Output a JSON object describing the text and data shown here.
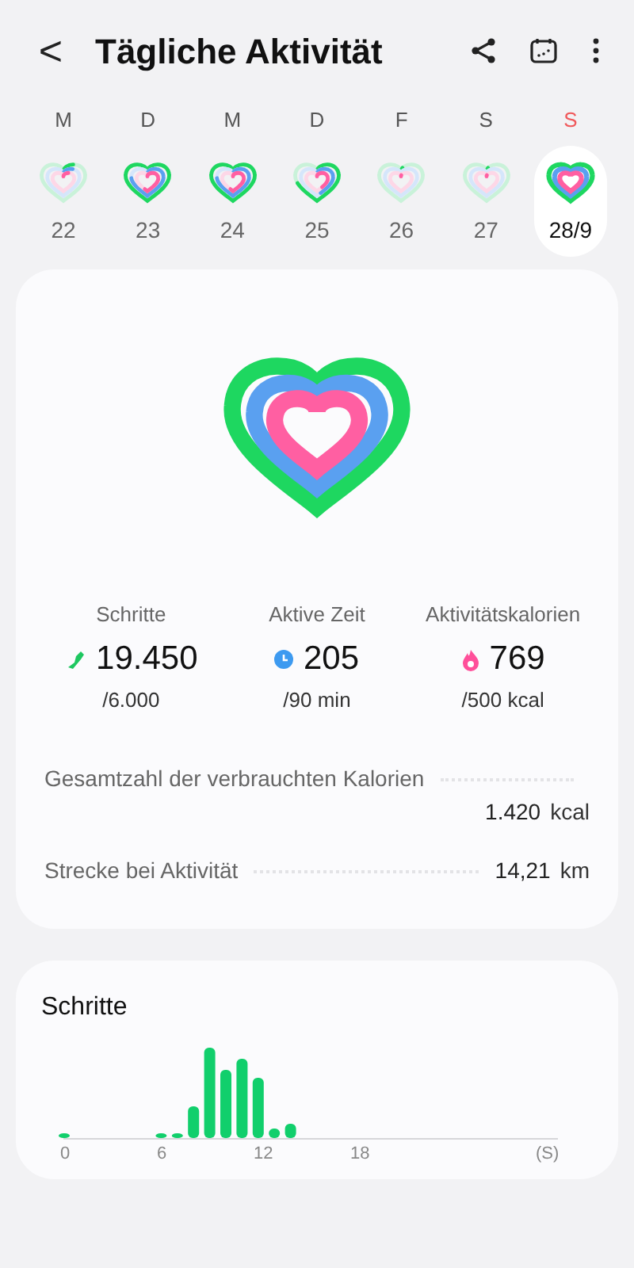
{
  "header": {
    "back": "<",
    "title": "Tägliche Aktivität"
  },
  "days": [
    {
      "weekday": "M",
      "date": "22",
      "sunday": false,
      "selected": false,
      "kind": "low"
    },
    {
      "weekday": "D",
      "date": "23",
      "sunday": false,
      "selected": false,
      "kind": "high"
    },
    {
      "weekday": "M",
      "date": "24",
      "sunday": false,
      "selected": false,
      "kind": "high"
    },
    {
      "weekday": "D",
      "date": "25",
      "sunday": false,
      "selected": false,
      "kind": "partial"
    },
    {
      "weekday": "F",
      "date": "26",
      "sunday": false,
      "selected": false,
      "kind": "none"
    },
    {
      "weekday": "S",
      "date": "27",
      "sunday": false,
      "selected": false,
      "kind": "none"
    },
    {
      "weekday": "S",
      "date": "28/9",
      "sunday": true,
      "selected": true,
      "kind": "full"
    }
  ],
  "summary": {
    "stats": [
      {
        "kind": "steps",
        "label": "Schritte",
        "value": "19.450",
        "goal": "/6.000"
      },
      {
        "kind": "time",
        "label": "Aktive Zeit",
        "value": "205",
        "goal": "/90 min"
      },
      {
        "kind": "calories",
        "label": "Aktivitätskalorien",
        "value": "769",
        "goal": "/500 kcal"
      }
    ],
    "details": [
      {
        "label": "Gesamtzahl der verbrauchten Kalorien",
        "value": "1.420",
        "unit": "kcal"
      },
      {
        "label": "Strecke bei Aktivität",
        "value": "14,21",
        "unit": "km"
      }
    ]
  },
  "steps_card": {
    "title": "Schritte",
    "axis_labels": [
      "0",
      "6",
      "12",
      "18",
      "(S)"
    ]
  }
}
